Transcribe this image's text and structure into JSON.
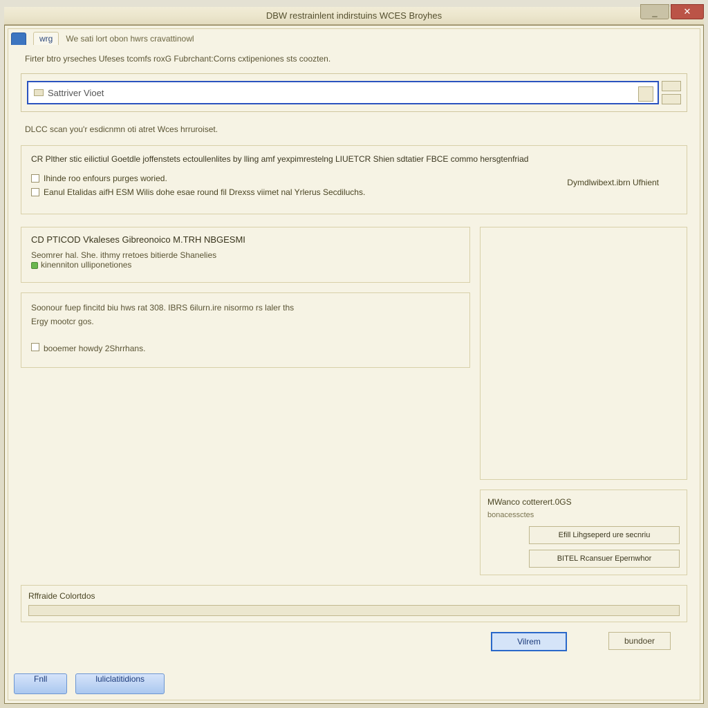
{
  "titlebar": {
    "title": "DBW restrainlent indirstuins WCES Broyhes"
  },
  "tabs": {
    "main_label": "wrg",
    "main_desc": "We sati lort obon hwrs cravattinowl"
  },
  "intro": "Firter btro yrseches Ufeses tcomfs roxG Fubrchant:Corns cxtipeniones sts coozten.",
  "combo": {
    "value": "Sattriver Vioet"
  },
  "post_combo": "DLCC scan you'r esdicnmn oti atret Wces hrruroiset.",
  "panel1": {
    "header": "CR Plther stic eilictiul Goetdle joffenstets ectoullenlites by lling amf yexpimrestelng LIUETCR Shien sdtatier FBCE commo hersgtenfriad",
    "opt1": "Ihinde roo enfours purges woried.",
    "opt2": "Eanul Etalidas aifH ESM Wilis dohe esae round fil Drexss viimet nal Yrlerus Secdiluchs.",
    "right": "Dymdlwibext.ibrn Ufhient"
  },
  "panel2": {
    "header": "CD PTICOD Vkaleses Gibreonoico M.TRH NBGESMI",
    "line1": "Seomrer hal. She. ithmy rretoes bitierde Shanelies",
    "line2": "kinenniton ulliponetiones"
  },
  "lower_left": {
    "line1": "Soonour fuep fincitd biu hws rat 308. IBRS 6ilurn.ire nisormo rs laler ths",
    "line2": "Ergy mootcr gos.",
    "line3": "booemer howdy 2Shrrhans."
  },
  "action_panel": {
    "header": "MWanco cotterert.0GS",
    "sub": "bonacessctes",
    "btn1": "Efill Lihgseperd ure secnriu",
    "btn2": "BITEL Rcansuer Epernwhor"
  },
  "progress": {
    "label": "Rffraide Colortdos"
  },
  "right_buttons": {
    "primary": "Vilrem",
    "secondary": "bundoer"
  },
  "bottom_left": {
    "btn1": "Fnll",
    "btn2": "luliclatitidions"
  }
}
